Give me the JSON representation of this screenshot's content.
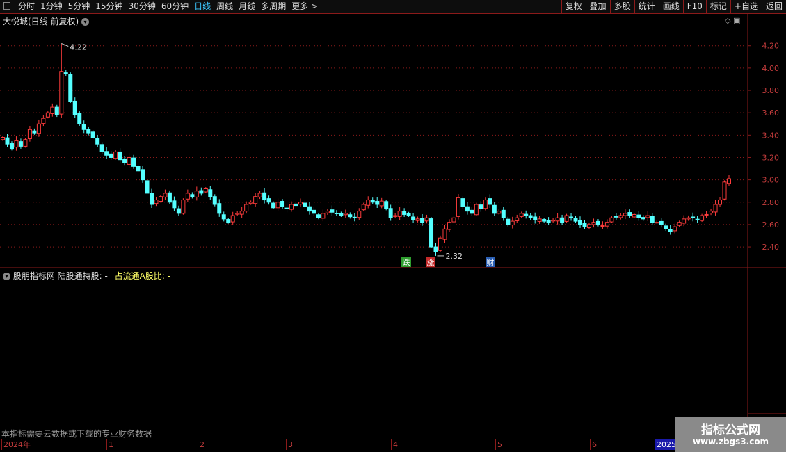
{
  "toolbar": {
    "periods": [
      "分时",
      "1分钟",
      "5分钟",
      "15分钟",
      "30分钟",
      "60分钟",
      "日线",
      "周线",
      "月线",
      "多周期",
      "更多 >"
    ],
    "active_period": "日线",
    "tools": [
      "复权",
      "叠加",
      "多股",
      "统计",
      "画线",
      "F10",
      "标记",
      "+自选",
      "返回"
    ]
  },
  "stock": {
    "title": "大悦城(日线 前复权)"
  },
  "indicator": {
    "title": "股朋指标网 陆股通持股: -",
    "ratio": "占流通A股比: -"
  },
  "notice": "本指标需要云数据或下载的专业财务数据",
  "watermark": {
    "line1": "指标公式网",
    "line2": "www.zbgs3.com"
  },
  "events": [
    {
      "label": "跌",
      "color": "#2e9e2e"
    },
    {
      "label": "涨",
      "color": "#c42a2a"
    },
    {
      "label": "财",
      "color": "#2a5fb4"
    }
  ],
  "date_axis": [
    "2024年",
    "1",
    "2",
    "3",
    "4",
    "5",
    "6",
    "2025"
  ],
  "chart_data": {
    "type": "candlestick",
    "y_ticks": [
      4.2,
      4.0,
      3.8,
      3.6,
      3.4,
      3.2,
      3.0,
      2.8,
      2.6,
      2.4
    ],
    "ylim": [
      2.22,
      4.36
    ],
    "high_label": "4.22",
    "low_label": "2.32",
    "colors": {
      "up": "#ff3c3c",
      "down": "#54ffff",
      "grid": "#8b1a1a",
      "tick": "#c43c3c"
    },
    "closes": [
      3.38,
      3.32,
      3.28,
      3.35,
      3.3,
      3.36,
      3.45,
      3.42,
      3.5,
      3.55,
      3.6,
      3.65,
      3.58,
      3.97,
      3.95,
      3.7,
      3.58,
      3.5,
      3.45,
      3.42,
      3.38,
      3.32,
      3.25,
      3.22,
      3.2,
      3.25,
      3.18,
      3.15,
      3.2,
      3.12,
      3.08,
      3.0,
      2.88,
      2.78,
      2.82,
      2.85,
      2.88,
      2.8,
      2.75,
      2.7,
      2.82,
      2.88,
      2.85,
      2.9,
      2.88,
      2.92,
      2.85,
      2.78,
      2.7,
      2.65,
      2.62,
      2.68,
      2.7,
      2.72,
      2.78,
      2.8,
      2.85,
      2.88,
      2.82,
      2.8,
      2.75,
      2.8,
      2.76,
      2.74,
      2.78,
      2.77,
      2.8,
      2.76,
      2.72,
      2.7,
      2.66,
      2.7,
      2.72,
      2.71,
      2.7,
      2.68,
      2.7,
      2.67,
      2.66,
      2.72,
      2.78,
      2.82,
      2.8,
      2.78,
      2.81,
      2.74,
      2.66,
      2.68,
      2.72,
      2.69,
      2.68,
      2.64,
      2.65,
      2.62,
      2.66,
      2.4,
      2.36,
      2.48,
      2.56,
      2.62,
      2.66,
      2.84,
      2.76,
      2.72,
      2.7,
      2.78,
      2.74,
      2.82,
      2.78,
      2.7,
      2.72,
      2.66,
      2.6,
      2.63,
      2.66,
      2.7,
      2.68,
      2.66,
      2.64,
      2.65,
      2.63,
      2.62,
      2.64,
      2.66,
      2.62,
      2.68,
      2.66,
      2.63,
      2.6,
      2.58,
      2.6,
      2.62,
      2.6,
      2.59,
      2.62,
      2.66,
      2.67,
      2.68,
      2.7,
      2.68,
      2.69,
      2.66,
      2.65,
      2.68,
      2.62,
      2.62,
      2.6,
      2.56,
      2.54,
      2.58,
      2.62,
      2.65,
      2.66,
      2.66,
      2.64,
      2.68,
      2.69,
      2.72,
      2.78,
      2.82,
      2.98,
      3.01
    ]
  }
}
